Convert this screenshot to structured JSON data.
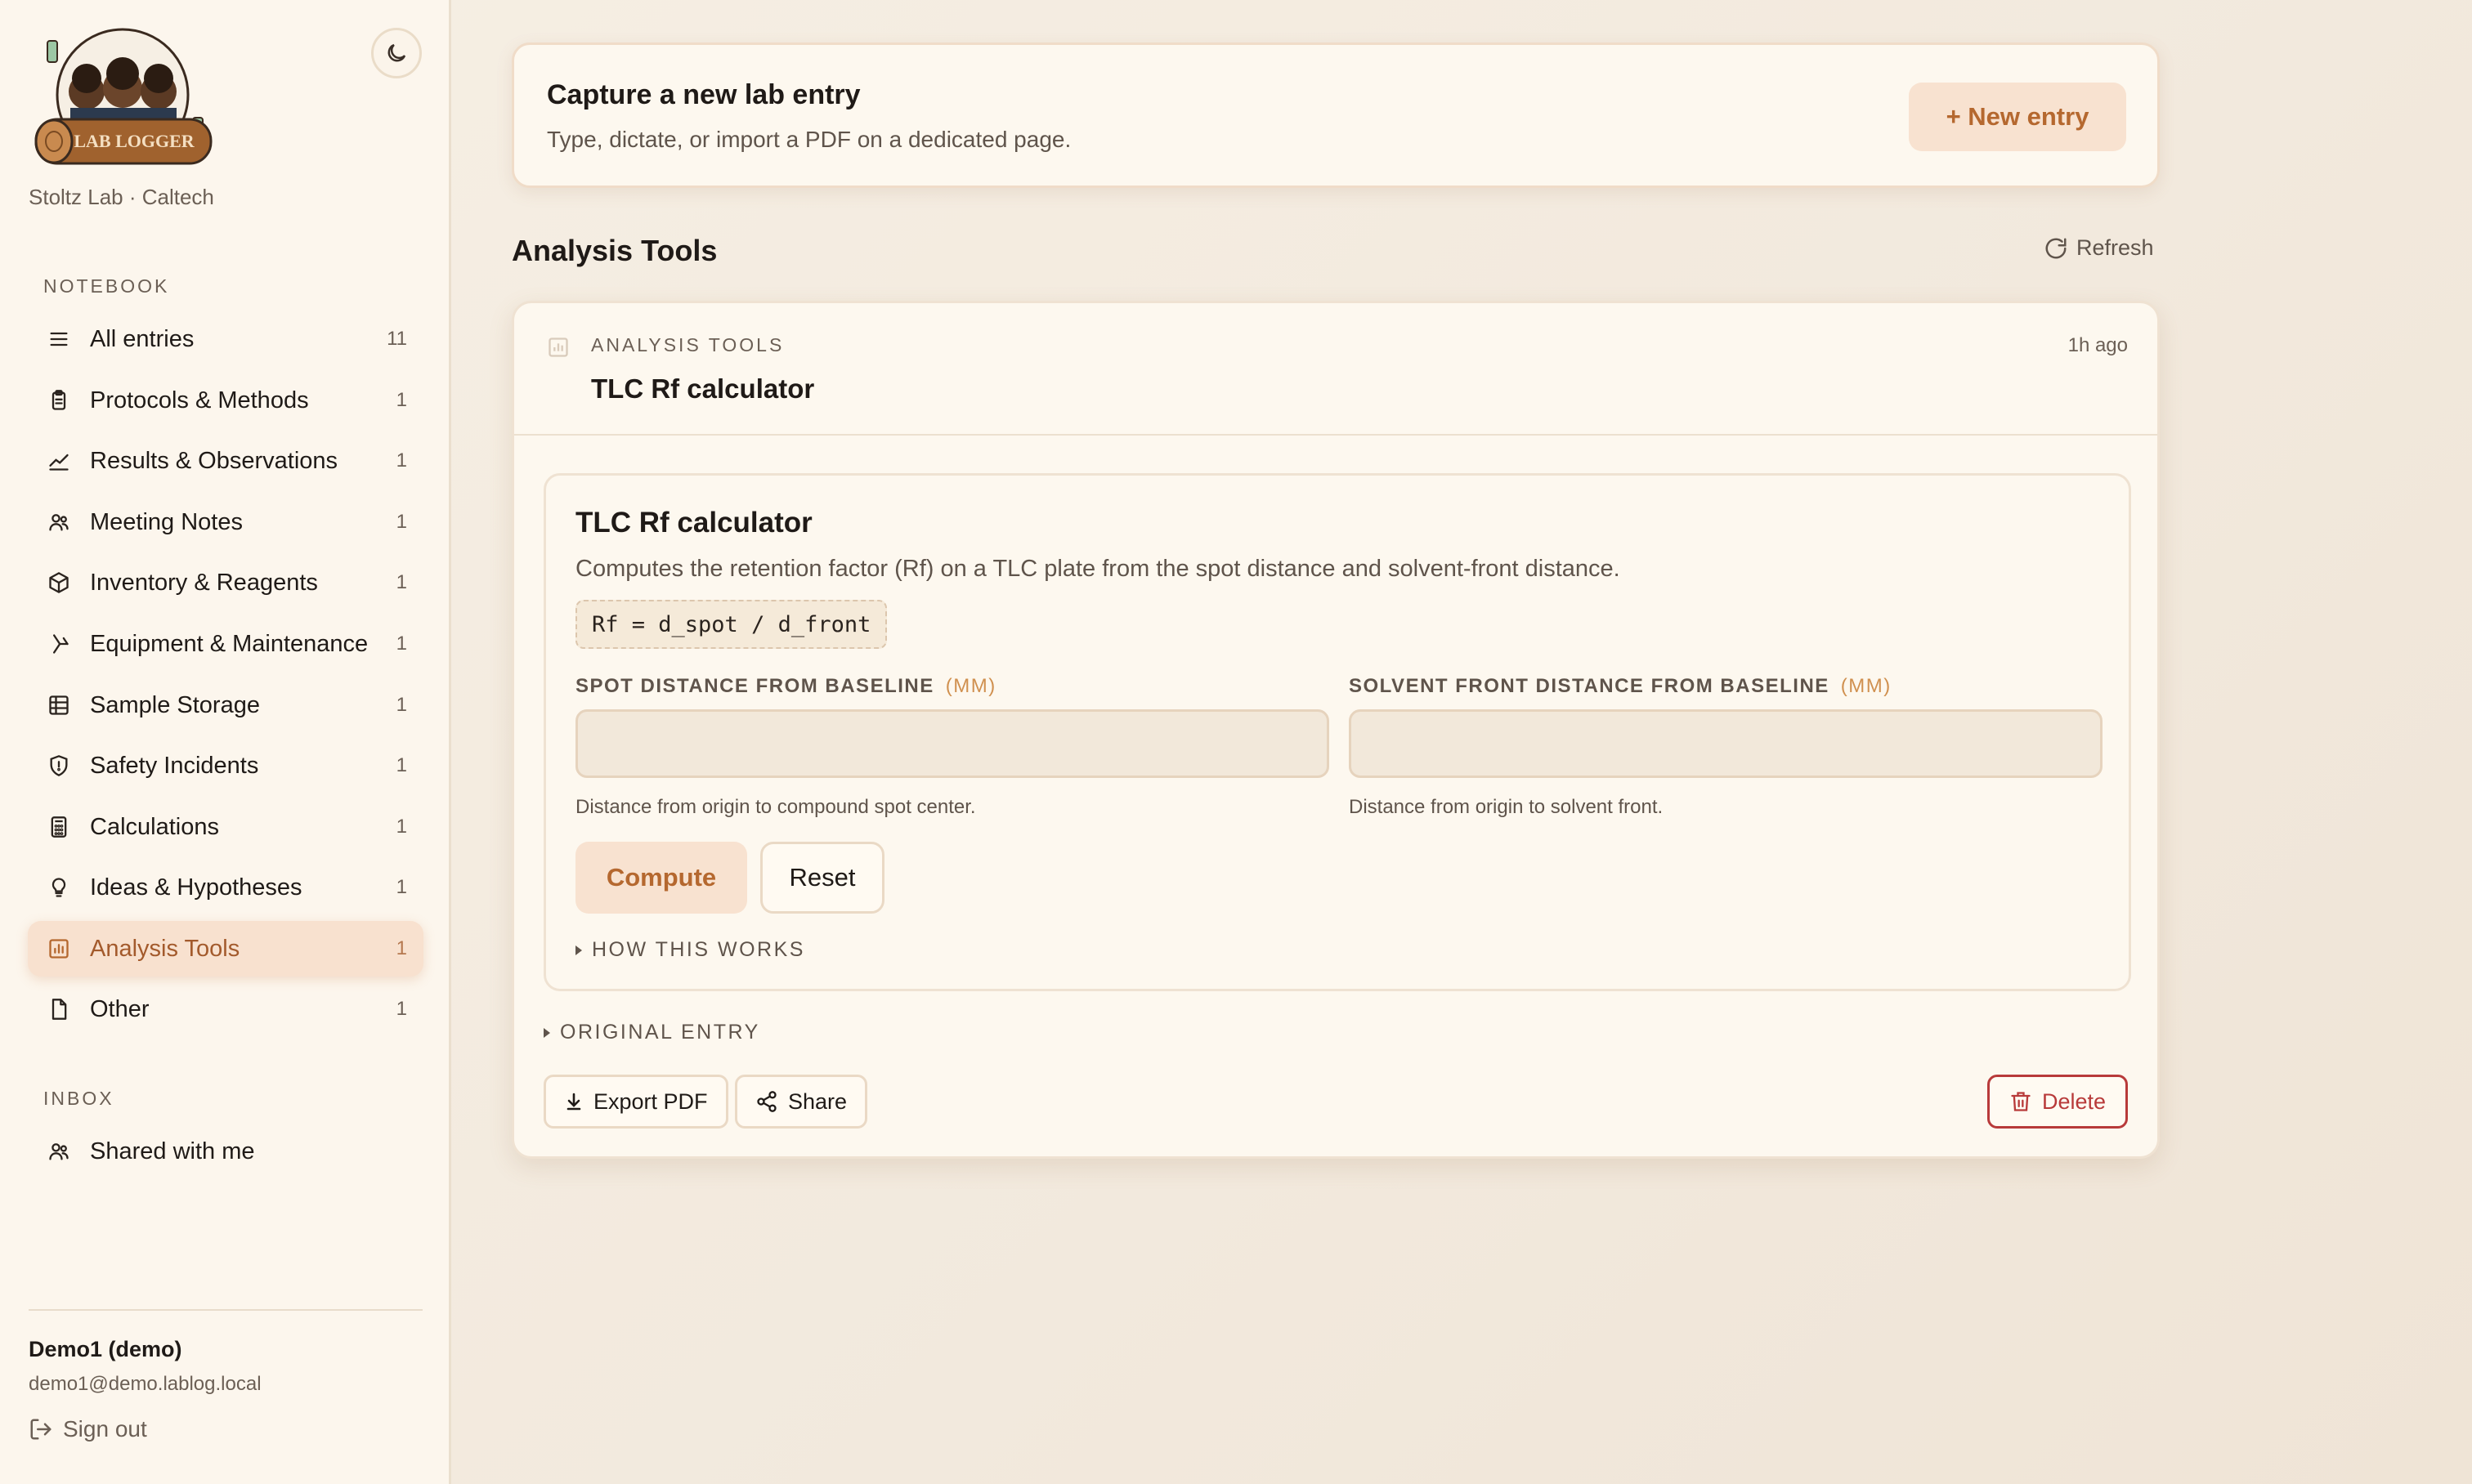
{
  "sidebar": {
    "org": "Stoltz Lab · Caltech",
    "logo_text": "LAB LOGGER",
    "notebook_label": "NOTEBOOK",
    "inbox_label": "INBOX",
    "items": [
      {
        "label": "All entries",
        "count": "11",
        "icon": "list-icon"
      },
      {
        "label": "Protocols & Methods",
        "count": "1",
        "icon": "clipboard-icon"
      },
      {
        "label": "Results & Observations",
        "count": "1",
        "icon": "trend-icon"
      },
      {
        "label": "Meeting Notes",
        "count": "1",
        "icon": "users-icon"
      },
      {
        "label": "Inventory & Reagents",
        "count": "1",
        "icon": "box-icon"
      },
      {
        "label": "Equipment & Maintenance",
        "count": "1",
        "icon": "branch-icon"
      },
      {
        "label": "Sample Storage",
        "count": "1",
        "icon": "grid-icon"
      },
      {
        "label": "Safety Incidents",
        "count": "1",
        "icon": "shield-icon"
      },
      {
        "label": "Calculations",
        "count": "1",
        "icon": "calculator-icon"
      },
      {
        "label": "Ideas & Hypotheses",
        "count": "1",
        "icon": "lightbulb-icon"
      },
      {
        "label": "Analysis Tools",
        "count": "1",
        "icon": "bar-chart-icon",
        "active": true
      },
      {
        "label": "Other",
        "count": "1",
        "icon": "file-icon"
      }
    ],
    "inbox_items": [
      {
        "label": "Shared with me",
        "icon": "users-icon"
      }
    ],
    "user": {
      "name": "Demo1 (demo)",
      "email": "demo1@demo.lablog.local"
    },
    "signout_label": "Sign out"
  },
  "capture": {
    "title": "Capture a new lab entry",
    "subtitle": "Type, dictate, or import a PDF on a dedicated page.",
    "button": "+ New entry"
  },
  "section": {
    "title": "Analysis Tools",
    "refresh": "Refresh"
  },
  "card": {
    "category": "ANALYSIS TOOLS",
    "time": "1h ago",
    "title": "TLC Rf calculator",
    "tool": {
      "title": "TLC Rf calculator",
      "description": "Computes the retention factor (Rf) on a TLC plate from the spot distance and solvent-front distance.",
      "formula": "Rf = d_spot / d_front",
      "fields": [
        {
          "label": "SPOT DISTANCE FROM BASELINE",
          "unit": "(MM)",
          "value": "",
          "help": "Distance from origin to compound spot center."
        },
        {
          "label": "SOLVENT FRONT DISTANCE FROM BASELINE",
          "unit": "(MM)",
          "value": "",
          "help": "Distance from origin to solvent front."
        }
      ],
      "compute": "Compute",
      "reset": "Reset",
      "how_it_works": "HOW THIS WORKS"
    },
    "original_entry": "ORIGINAL ENTRY",
    "export_pdf": "Export PDF",
    "share": "Share",
    "delete": "Delete"
  },
  "colors": {
    "accent": "#b5682f",
    "active_bg": "#f8e1cf",
    "danger": "#b83a3a"
  }
}
